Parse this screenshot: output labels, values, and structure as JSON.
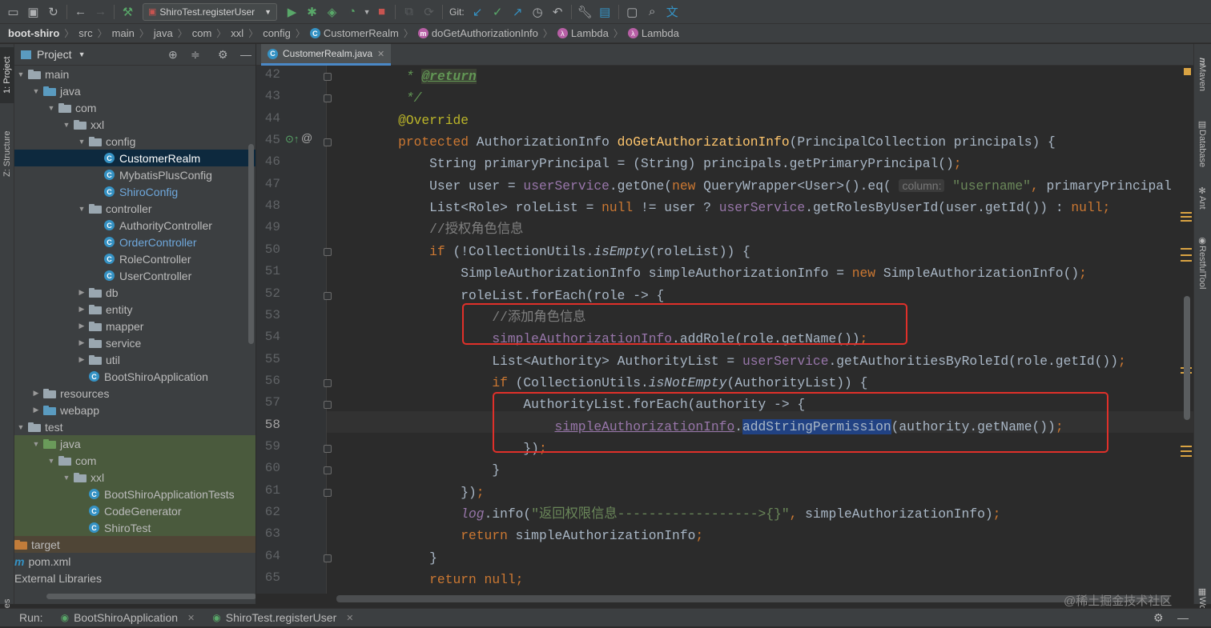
{
  "toolbar": {
    "run_config": "ShiroTest.registerUser",
    "git_label": "Git:"
  },
  "breadcrumbs": [
    "boot-shiro",
    "src",
    "main",
    "java",
    "com",
    "xxl",
    "config",
    "CustomerRealm",
    "doGetAuthorizationInfo",
    "Lambda",
    "Lambda"
  ],
  "left_tabs": {
    "project": "1: Project",
    "structure": "Z: Structure",
    "favorites": "vorites"
  },
  "project_panel": {
    "title": "Project",
    "tree": [
      {
        "label": "main",
        "level": 0,
        "arrow": "down",
        "icon": "folder-grey",
        "style": ""
      },
      {
        "label": "java",
        "level": 1,
        "arrow": "down",
        "icon": "folder-blue",
        "style": ""
      },
      {
        "label": "com",
        "level": 2,
        "arrow": "down",
        "icon": "folder-grey",
        "style": ""
      },
      {
        "label": "xxl",
        "level": 3,
        "arrow": "down",
        "icon": "folder-grey",
        "style": ""
      },
      {
        "label": "config",
        "level": 4,
        "arrow": "down",
        "icon": "folder-grey",
        "style": ""
      },
      {
        "label": "CustomerRealm",
        "level": 5,
        "arrow": "",
        "icon": "class",
        "style": "selected"
      },
      {
        "label": "MybatisPlusConfig",
        "level": 5,
        "arrow": "",
        "icon": "class",
        "style": ""
      },
      {
        "label": "ShiroConfig",
        "level": 5,
        "arrow": "",
        "icon": "class",
        "style": "blue"
      },
      {
        "label": "controller",
        "level": 4,
        "arrow": "down",
        "icon": "folder-grey",
        "style": ""
      },
      {
        "label": "AuthorityController",
        "level": 5,
        "arrow": "",
        "icon": "class",
        "style": ""
      },
      {
        "label": "OrderController",
        "level": 5,
        "arrow": "",
        "icon": "class",
        "style": "blue"
      },
      {
        "label": "RoleController",
        "level": 5,
        "arrow": "",
        "icon": "class",
        "style": ""
      },
      {
        "label": "UserController",
        "level": 5,
        "arrow": "",
        "icon": "class",
        "style": ""
      },
      {
        "label": "db",
        "level": 4,
        "arrow": "right",
        "icon": "folder-grey",
        "style": ""
      },
      {
        "label": "entity",
        "level": 4,
        "arrow": "right",
        "icon": "folder-grey",
        "style": ""
      },
      {
        "label": "mapper",
        "level": 4,
        "arrow": "right",
        "icon": "folder-grey",
        "style": ""
      },
      {
        "label": "service",
        "level": 4,
        "arrow": "right",
        "icon": "folder-grey",
        "style": ""
      },
      {
        "label": "util",
        "level": 4,
        "arrow": "right",
        "icon": "folder-grey",
        "style": ""
      },
      {
        "label": "BootShiroApplication",
        "level": 4,
        "arrow": "",
        "icon": "class",
        "style": ""
      },
      {
        "label": "resources",
        "level": 1,
        "arrow": "right",
        "icon": "folder-grey",
        "style": ""
      },
      {
        "label": "webapp",
        "level": 1,
        "arrow": "right",
        "icon": "folder-blue",
        "style": ""
      },
      {
        "label": "test",
        "level": 0,
        "arrow": "down",
        "icon": "folder-grey",
        "style": ""
      },
      {
        "label": "java",
        "level": 1,
        "arrow": "down",
        "icon": "folder-green",
        "style": "green"
      },
      {
        "label": "com",
        "level": 2,
        "arrow": "down",
        "icon": "folder-grey",
        "style": "green"
      },
      {
        "label": "xxl",
        "level": 3,
        "arrow": "down",
        "icon": "folder-grey",
        "style": "green"
      },
      {
        "label": "BootShiroApplicationTests",
        "level": 4,
        "arrow": "",
        "icon": "class",
        "style": "green"
      },
      {
        "label": "CodeGenerator",
        "level": 4,
        "arrow": "",
        "icon": "class",
        "style": "green"
      },
      {
        "label": "ShiroTest",
        "level": 4,
        "arrow": "",
        "icon": "class",
        "style": "green"
      },
      {
        "label": "target",
        "level": -1,
        "arrow": "",
        "icon": "folder-orange",
        "style": "orange"
      },
      {
        "label": "pom.xml",
        "level": -1,
        "arrow": "",
        "icon": "maven",
        "style": ""
      },
      {
        "label": "External Libraries",
        "level": -1,
        "arrow": "",
        "icon": "none",
        "style": ""
      }
    ]
  },
  "editor": {
    "tab_label": "CustomerRealm.java",
    "current_line": 58,
    "lines": [
      {
        "n": 42,
        "html": [
          [
            "doc",
            "     * "
          ],
          [
            "docref",
            "@return"
          ]
        ]
      },
      {
        "n": 43,
        "html": [
          [
            "doc",
            "     */"
          ]
        ]
      },
      {
        "n": 44,
        "html": [
          [
            "ann",
            "    @Override"
          ]
        ]
      },
      {
        "n": 45,
        "html": [
          [
            "kw",
            "    protected "
          ],
          [
            "",
            "AuthorizationInfo "
          ],
          [
            "fn",
            "doGetAuthorizationInfo"
          ],
          [
            "",
            "(PrincipalCollection principals) {"
          ]
        ]
      },
      {
        "n": 46,
        "html": [
          [
            "",
            "        String primaryPrincipal = (String) principals.getPrimaryPrincipal()"
          ],
          [
            "kw",
            ";"
          ]
        ]
      },
      {
        "n": 47,
        "html": [
          [
            "",
            "        User user = "
          ],
          [
            "fld",
            "userService"
          ],
          [
            "",
            ".getOne("
          ],
          [
            "kw",
            "new "
          ],
          [
            "",
            "QueryWrapper<User>().eq( "
          ],
          [
            "hint",
            "column:"
          ],
          [
            "str",
            " \"username\""
          ],
          [
            "kw",
            ", "
          ],
          [
            "",
            "primaryPrincipal"
          ]
        ]
      },
      {
        "n": 48,
        "html": [
          [
            "",
            "        List<Role> roleList = "
          ],
          [
            "kw",
            "null "
          ],
          [
            "",
            "!= user ? "
          ],
          [
            "fld",
            "userService"
          ],
          [
            "",
            ".getRolesByUserId(user.getId()) : "
          ],
          [
            "kw",
            "null;"
          ]
        ]
      },
      {
        "n": 49,
        "html": [
          [
            "cm",
            "        //授权角色信息"
          ]
        ]
      },
      {
        "n": 50,
        "html": [
          [
            "kw",
            "        if "
          ],
          [
            "",
            "(!CollectionUtils."
          ],
          [
            "it",
            "isEmpty"
          ],
          [
            "",
            "(roleList)) {"
          ]
        ]
      },
      {
        "n": 51,
        "html": [
          [
            "",
            "            SimpleAuthorizationInfo simpleAuthorizationInfo = "
          ],
          [
            "kw",
            "new "
          ],
          [
            "",
            "SimpleAuthorizationInfo()"
          ],
          [
            "kw",
            ";"
          ]
        ]
      },
      {
        "n": 52,
        "html": [
          [
            "",
            "            roleList.forEach(role -> {"
          ]
        ]
      },
      {
        "n": 53,
        "html": [
          [
            "cm",
            "                //添加角色信息"
          ]
        ]
      },
      {
        "n": 54,
        "html": [
          [
            "",
            "                "
          ],
          [
            "ul",
            "simpleAuthorizationInfo"
          ],
          [
            "",
            ".addRole(role.getName())"
          ],
          [
            "kw",
            ";"
          ]
        ]
      },
      {
        "n": 55,
        "html": [
          [
            "",
            "                List<Authority> AuthorityList = "
          ],
          [
            "fld",
            "userService"
          ],
          [
            "",
            ".getAuthoritiesByRoleId(role.getId())"
          ],
          [
            "kw",
            ";"
          ]
        ]
      },
      {
        "n": 56,
        "html": [
          [
            "kw",
            "                if "
          ],
          [
            "",
            "(CollectionUtils."
          ],
          [
            "it",
            "isNotEmpty"
          ],
          [
            "",
            "(AuthorityList)) {"
          ]
        ]
      },
      {
        "n": 57,
        "html": [
          [
            "",
            "                    AuthorityList.forEach(authority -> {"
          ]
        ]
      },
      {
        "n": 58,
        "html": [
          [
            "",
            "                        "
          ],
          [
            "ul",
            "simpleAuthorizationInfo"
          ],
          [
            "",
            "."
          ],
          [
            "sel2",
            "addStringPermission"
          ],
          [
            "",
            "(authority.getName())"
          ],
          [
            "kw",
            ";"
          ]
        ]
      },
      {
        "n": 59,
        "html": [
          [
            "",
            "                    })"
          ],
          [
            "kw",
            ";"
          ]
        ]
      },
      {
        "n": 60,
        "html": [
          [
            "",
            "                }"
          ]
        ]
      },
      {
        "n": 61,
        "html": [
          [
            "",
            "            })"
          ],
          [
            "kw",
            ";"
          ]
        ]
      },
      {
        "n": 62,
        "html": [
          [
            "fld it",
            "            log"
          ],
          [
            "",
            ".info("
          ],
          [
            "str",
            "\"返回权限信息------------------>{}\""
          ],
          [
            "kw",
            ", "
          ],
          [
            "",
            "simpleAuthorizationInfo)"
          ],
          [
            "kw",
            ";"
          ]
        ]
      },
      {
        "n": 63,
        "html": [
          [
            "kw",
            "            return "
          ],
          [
            "",
            "simpleAuthorizationInfo"
          ],
          [
            "kw",
            ";"
          ]
        ]
      },
      {
        "n": 64,
        "html": [
          [
            "",
            "        }"
          ]
        ]
      },
      {
        "n": 65,
        "html": [
          [
            "kw",
            "        return null;"
          ]
        ]
      },
      {
        "n": 66,
        "html": [
          [
            "",
            "    }"
          ]
        ]
      }
    ]
  },
  "right_tabs": [
    "Maven",
    "Database",
    "Ant",
    "RestfulTool",
    "Word B"
  ],
  "statusbar": {
    "run_label": "Run:",
    "run_tab_1": "BootShiroApplication",
    "run_tab_2": "ShiroTest.registerUser"
  },
  "watermark": "@稀土掘金技术社区",
  "colors": {
    "keyword": "#cc7832",
    "string": "#6a8759",
    "field": "#9876aa",
    "method": "#ffc66d",
    "annotation": "#bbb529",
    "highlight_box": "#e0302a"
  }
}
